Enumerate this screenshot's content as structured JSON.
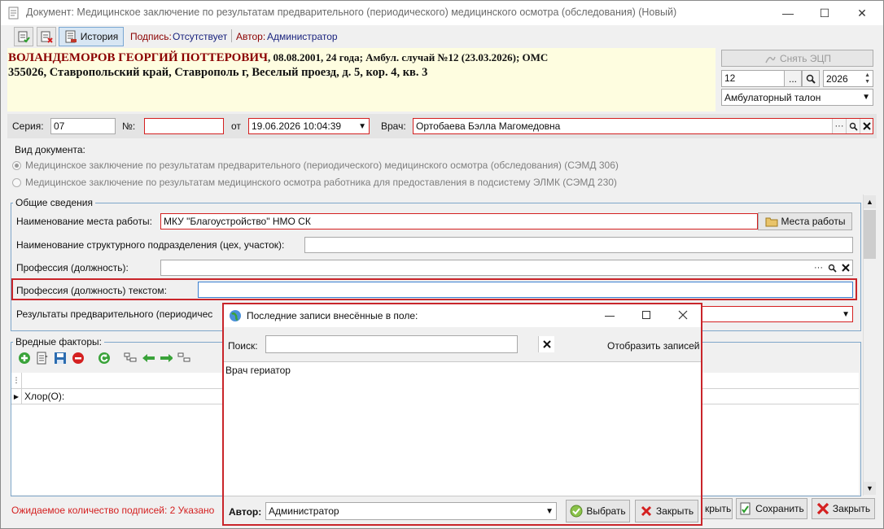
{
  "window": {
    "title": "Документ: Медицинское заключение по результатам предварительного (периодического) медицинского осмотра (обследования) (Новый)",
    "minimize": "—",
    "maximize": "☐",
    "close": "✕"
  },
  "toolbar": {
    "history_label": "История",
    "signature_label": "Подпись:",
    "signature_value": "Отсутствует",
    "author_label": "Автор:",
    "author_value": "Администратор"
  },
  "patient": {
    "name": "ВОЛАНДЕМОРОВ ГЕОРГИЙ ПОТТЕРОВИЧ",
    "details": ", 08.08.2001, 24 года; Амбул. случай №12 (23.03.2026); ОМС",
    "address": "355026, Ставропольский край, Ставрополь г, Веселый проезд, д. 5, кор. 4, кв. 3"
  },
  "right_panel": {
    "remove_ecp_label": "Снять ЭЦП",
    "number_value": "12",
    "ellipsis": "...",
    "year_value": "2026",
    "type_value": "Амбулаторный талон"
  },
  "doc_fields": {
    "series_label": "Серия:",
    "series_value": "07",
    "number_label": "№:",
    "number_value": "",
    "date_label": "от",
    "date_value": "19.06.2026 10:04:39",
    "doctor_label": "Врач:",
    "doctor_value": "Ортобаева Бэлла Магомедовна"
  },
  "doc_type": {
    "label": "Вид документа:",
    "option1": "Медицинское заключение по результатам предварительного (периодического) медицинского осмотра (обследования) (СЭМД 306)",
    "option2": "Медицинское заключение по результатам медицинского осмотра работника для предоставления в подсистему ЭЛМК (СЭМД 230)"
  },
  "general": {
    "legend": "Общие сведения",
    "workplace_label": "Наименование места работы:",
    "workplace_value": "МКУ \"Благоустройство\" НМО СК",
    "workplaces_button": "Места работы",
    "subdivision_label": "Наименование структурного подразделения (цех, участок):",
    "subdivision_value": "",
    "profession_label": "Профессия (должность):",
    "profession_value": "",
    "profession_text_label": "Профессия (должность) текстом:",
    "profession_text_value": "",
    "results_label": "Результаты предварительного (периодичес"
  },
  "harmful": {
    "legend": "Вредные факторы:",
    "row1": "Хлор(О):"
  },
  "footer": {
    "signatures_text": "Ожидаемое количество подписей: 2 Указано",
    "close_partial": "крыть",
    "save_label": "Сохранить",
    "close_label": "Закрыть"
  },
  "dialog": {
    "title": "Последние записи внесённые в поле:",
    "search_label": "Поиск:",
    "search_value": "",
    "show_records_label": "Отобразить записей",
    "items": [
      "Врач гериатор"
    ],
    "author_label": "Автор:",
    "author_value": "Администратор",
    "select_button": "Выбрать",
    "close_button": "Закрыть"
  },
  "colors": {
    "accent_red": "#c9252a",
    "patient_name": "#8b0000",
    "header_bg": "#fefde0",
    "link_blue": "#1a237e"
  }
}
